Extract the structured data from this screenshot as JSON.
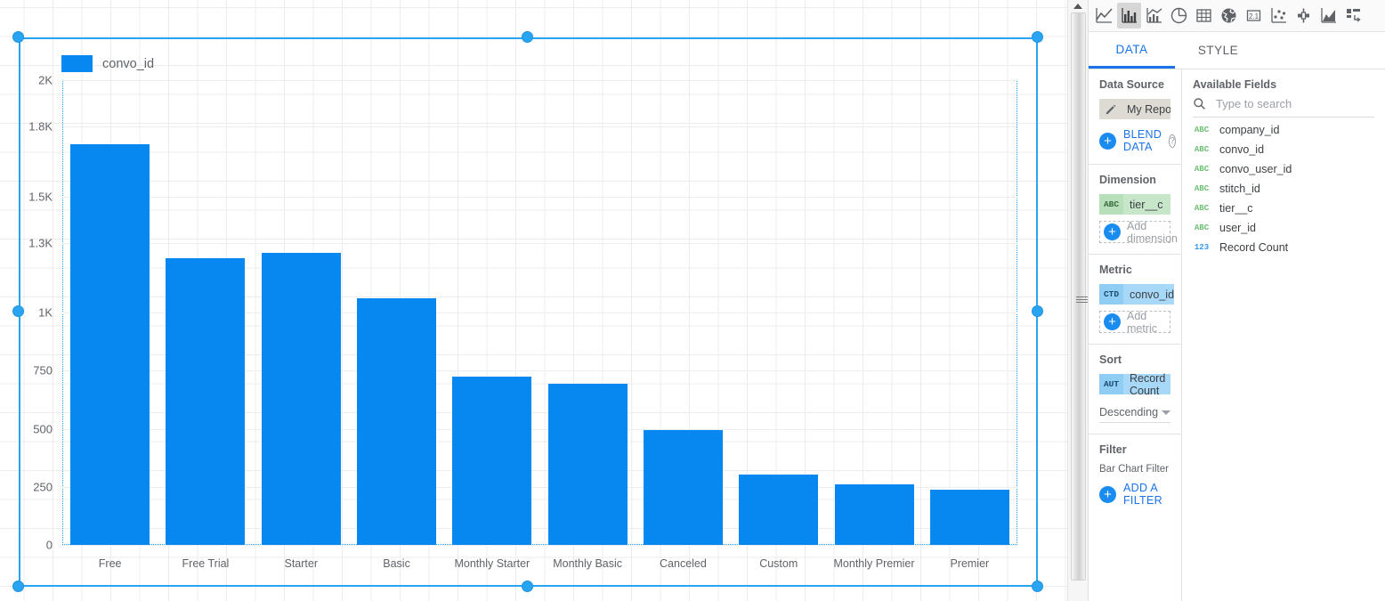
{
  "viz_toolbar": {
    "items": [
      {
        "name": "line-chart-icon",
        "selected": false
      },
      {
        "name": "bar-chart-icon",
        "selected": true
      },
      {
        "name": "combo-chart-icon",
        "selected": false
      },
      {
        "name": "pie-chart-icon",
        "selected": false
      },
      {
        "name": "table-icon",
        "selected": false
      },
      {
        "name": "geo-map-icon",
        "selected": false
      },
      {
        "name": "scorecard-icon",
        "selected": false,
        "label": "2.1"
      },
      {
        "name": "scatter-chart-icon",
        "selected": false
      },
      {
        "name": "bullet-chart-icon",
        "selected": false
      },
      {
        "name": "area-chart-icon",
        "selected": false
      },
      {
        "name": "treemap-icon",
        "selected": false
      }
    ]
  },
  "tabs": [
    {
      "label": "DATA",
      "active": true
    },
    {
      "label": "STYLE",
      "active": false
    }
  ],
  "data_source": {
    "title": "Data Source",
    "name": "My Report Data So...",
    "edit_icon": "pencil-icon",
    "blend_label": "BLEND DATA",
    "help_icon": "help-circle-icon"
  },
  "dimension": {
    "title": "Dimension",
    "chips": [
      {
        "type": "ABC",
        "name": "tier__c"
      }
    ],
    "add_label": "Add dimension"
  },
  "metric": {
    "title": "Metric",
    "chips": [
      {
        "type": "CTD",
        "name": "convo_id"
      }
    ],
    "add_label": "Add metric"
  },
  "sort": {
    "title": "Sort",
    "chips": [
      {
        "type": "AUT",
        "name": "Record Count"
      }
    ],
    "order": "Descending"
  },
  "filter": {
    "title": "Filter",
    "sub_label": "Bar Chart Filter",
    "add_label": "ADD A FILTER"
  },
  "available_fields": {
    "title": "Available Fields",
    "search_placeholder": "Type to search",
    "search_value": "",
    "search_icon": "search-icon",
    "fields": [
      {
        "type": "ABC",
        "name": "company_id"
      },
      {
        "type": "ABC",
        "name": "convo_id"
      },
      {
        "type": "ABC",
        "name": "convo_user_id"
      },
      {
        "type": "ABC",
        "name": "stitch_id"
      },
      {
        "type": "ABC",
        "name": "tier__c"
      },
      {
        "type": "ABC",
        "name": "user_id"
      },
      {
        "type": "123",
        "name": "Record Count"
      }
    ]
  },
  "colors": {
    "bar": "#0688f0",
    "accent": "#1a73e8",
    "selection": "#29a4f2",
    "dimension_chip": "#c8e6c9",
    "metric_chip": "#a8d8f8"
  },
  "chart_data": {
    "type": "bar",
    "title": "",
    "legend": [
      "convo_id"
    ],
    "legend_position": "top-left",
    "xlabel": "",
    "ylabel": "",
    "grid": true,
    "ylim": [
      0,
      2000
    ],
    "yticks": [
      0,
      250,
      500,
      750,
      1000,
      1300,
      1500,
      1800,
      2000
    ],
    "ytick_labels": [
      "0",
      "250",
      "500",
      "750",
      "1K",
      "1.3K",
      "1.5K",
      "1.8K",
      "2K"
    ],
    "categories": [
      "Free",
      "Free Trial",
      "Starter",
      "Basic",
      "Monthly Starter",
      "Monthly Basic",
      "Canceled",
      "Custom",
      "Monthly Premier",
      "Premier"
    ],
    "series": [
      {
        "name": "convo_id",
        "color": "#0688f0",
        "values": [
          1725,
          1235,
          1255,
          1060,
          725,
          693,
          495,
          304,
          261,
          238
        ]
      }
    ]
  }
}
